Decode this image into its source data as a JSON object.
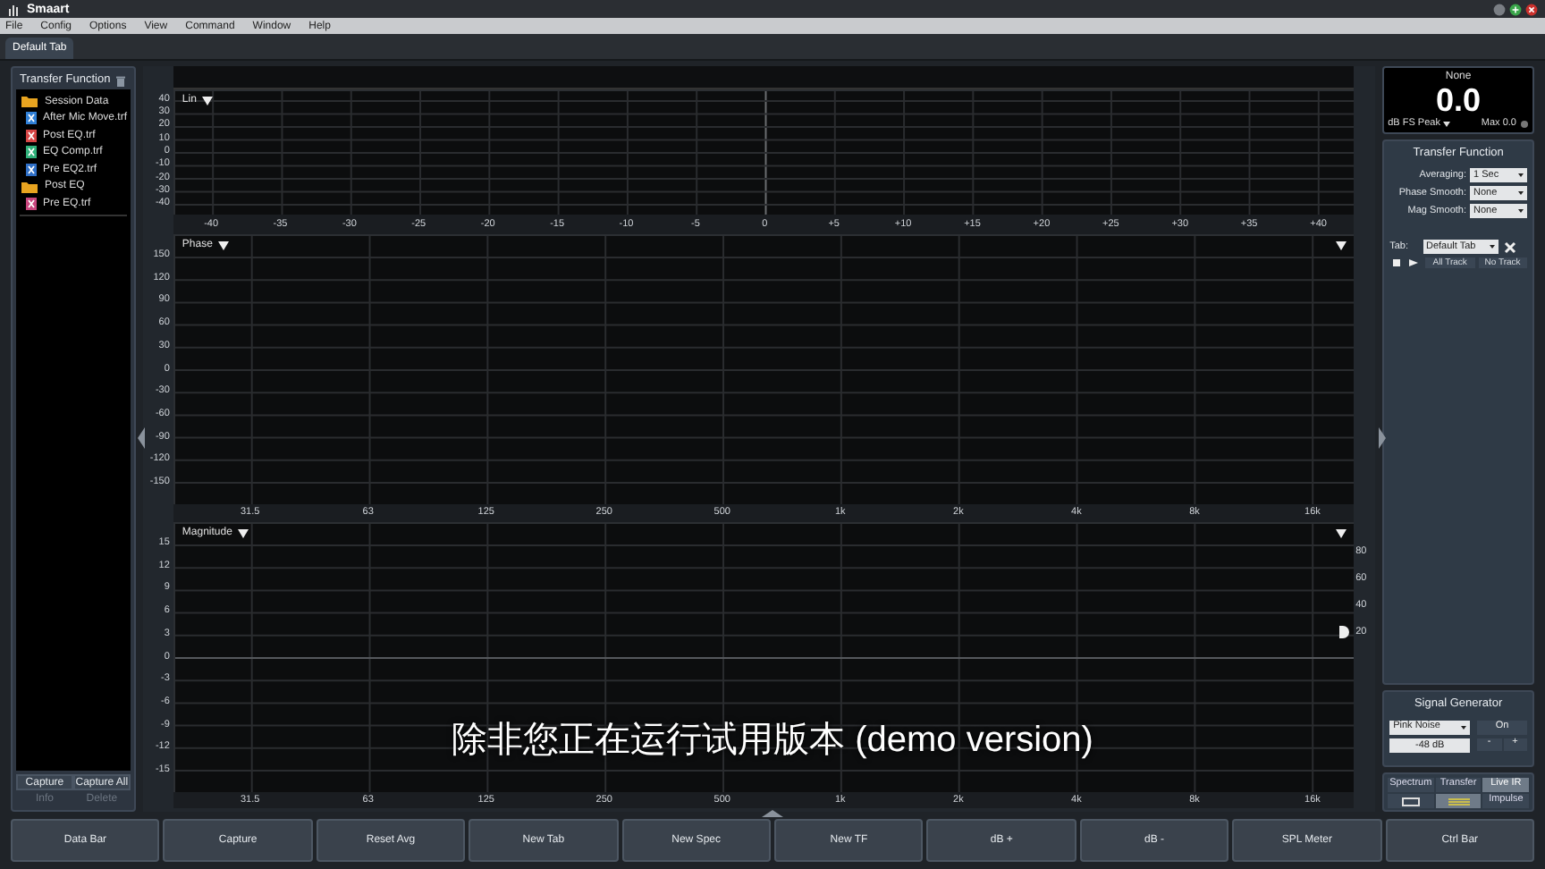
{
  "window": {
    "title": "Smaart"
  },
  "menu": [
    "File",
    "Config",
    "Options",
    "View",
    "Command",
    "Window",
    "Help"
  ],
  "tabs": [
    {
      "label": "Default Tab",
      "selected": true
    }
  ],
  "data_panel": {
    "title": "Transfer Function",
    "tree": [
      {
        "kind": "folder",
        "label": "Session Data",
        "children": [
          {
            "kind": "file",
            "label": "After Mic Move.trf",
            "color": "#2f7fd6"
          },
          {
            "kind": "file",
            "label": "Post EQ.trf",
            "color": "#d64545"
          },
          {
            "kind": "file",
            "label": "EQ Comp.trf",
            "color": "#2fb07a"
          },
          {
            "kind": "file",
            "label": "Pre EQ2.trf",
            "color": "#2f6fc6"
          }
        ]
      },
      {
        "kind": "folder",
        "label": "Post EQ",
        "children": [
          {
            "kind": "file",
            "label": "Pre EQ.trf",
            "color": "#c8467e"
          }
        ]
      }
    ],
    "buttons": [
      {
        "label": "Capture",
        "disabled": false
      },
      {
        "label": "Capture All",
        "disabled": false
      },
      {
        "label": "Info",
        "disabled": true
      },
      {
        "label": "Delete",
        "disabled": true
      }
    ]
  },
  "panels": [
    {
      "label": "Lin",
      "y_ticks": [
        "40",
        "30",
        "20",
        "10",
        "0",
        "-10",
        "-20",
        "-30",
        "-40"
      ],
      "x_axis": {
        "kind": "lin",
        "ticks": [
          "-40",
          "-35",
          "-30",
          "-25",
          "-20",
          "-15",
          "-10",
          "-5",
          "0",
          "+5",
          "+10",
          "+15",
          "+20",
          "+25",
          "+30",
          "+35",
          "+40"
        ]
      }
    },
    {
      "label": "Phase",
      "corner_menu": true,
      "y_ticks": [
        "150",
        "120",
        "90",
        "60",
        "30",
        "0",
        "-30",
        "-60",
        "-90",
        "-120",
        "-150"
      ],
      "x_axis": {
        "kind": "log",
        "ticks": [
          "31.5",
          "63",
          "125",
          "250",
          "500",
          "1k",
          "2k",
          "4k",
          "8k",
          "16k"
        ]
      }
    },
    {
      "label": "Magnitude",
      "corner_menu": true,
      "y_ticks": [
        "15",
        "12",
        "9",
        "6",
        "3",
        "0",
        "-3",
        "-6",
        "-9",
        "-12",
        "-15"
      ],
      "right_ticks": [
        "80",
        "60",
        "40",
        "20"
      ],
      "x_axis": {
        "kind": "log",
        "ticks": [
          "31.5",
          "63",
          "125",
          "250",
          "500",
          "1k",
          "2k",
          "4k",
          "8k",
          "16k"
        ]
      }
    }
  ],
  "meter": {
    "source": "None",
    "value": "0.0",
    "unit": "dB FS Peak",
    "max": "Max 0.0"
  },
  "tf_settings": {
    "title": "Transfer Function",
    "fields": [
      {
        "label": "Averaging:",
        "value": "1 Sec"
      },
      {
        "label": "Phase Smooth:",
        "value": "None"
      },
      {
        "label": "Mag Smooth:",
        "value": "None"
      }
    ],
    "tab_label": "Tab:",
    "tab_value": "Default Tab",
    "track_buttons": [
      "All Track",
      "No Track"
    ]
  },
  "signal_generator": {
    "title": "Signal Generator",
    "signal": "Pink Noise",
    "level": "-48 dB",
    "power": "On",
    "steps": [
      "-",
      "+"
    ]
  },
  "mode_tabs": [
    {
      "label": "Spectrum",
      "selected": false
    },
    {
      "label": "Transfer",
      "selected": false
    },
    {
      "label": "Live IR",
      "selected": true
    }
  ],
  "view_buttons": [
    {
      "kind": "box",
      "selected": false
    },
    {
      "kind": "lines",
      "selected": true
    },
    {
      "kind": "text",
      "label": "Impulse",
      "selected": false
    }
  ],
  "command_bar": [
    "Data Bar",
    "Capture",
    "Reset Avg",
    "New Tab",
    "New Spec",
    "New TF",
    "dB +",
    "dB -",
    "SPL Meter",
    "Ctrl Bar"
  ],
  "caption": "除非您正在运行试用版本 (demo version)"
}
